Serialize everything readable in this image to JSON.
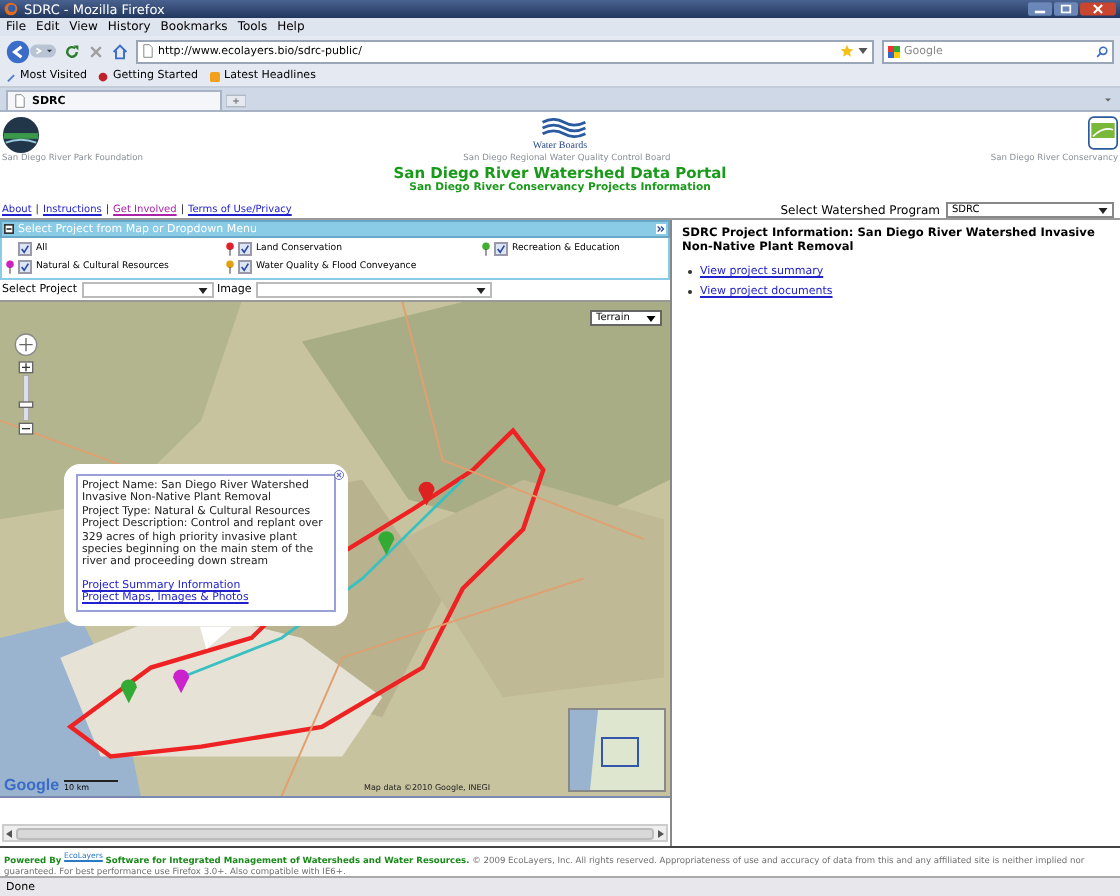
{
  "window": {
    "title": "SDRC - Mozilla Firefox"
  },
  "menu": [
    "File",
    "Edit",
    "View",
    "History",
    "Bookmarks",
    "Tools",
    "Help"
  ],
  "address_bar": {
    "value": "http://www.ecolayers.bio/sdrc-public/"
  },
  "search": {
    "placeholder": "Google"
  },
  "bookmarks": [
    "Most Visited",
    "Getting Started",
    "Latest Headlines"
  ],
  "tabs": [
    {
      "label": "SDRC",
      "selected": true
    }
  ],
  "header": {
    "partners": [
      "San Diego River Park Foundation",
      "San Diego Regional Water Quality Control Board",
      "San Diego River Conservancy"
    ],
    "logo_text": "Water Boards",
    "title": "San Diego River Watershed Data Portal",
    "subtitle": "San Diego River Conservancy Projects Information"
  },
  "links": [
    {
      "label": "About",
      "visited": false
    },
    {
      "label": "Instructions",
      "visited": false
    },
    {
      "label": "Get Involved",
      "visited": true
    },
    {
      "label": "Terms of Use/Privacy",
      "visited": false
    }
  ],
  "link_separator": "|",
  "watershed_select": {
    "label": "Select Watershed Program",
    "value": "SDRC"
  },
  "project_panel": {
    "title": "Select Project from Map or Dropdown Menu",
    "filters": [
      {
        "label": "All",
        "checked": true
      },
      {
        "label": "Land Conservation",
        "checked": true,
        "color": "#e0202a"
      },
      {
        "label": "Recreation & Education",
        "checked": true,
        "color": "#40b030"
      },
      {
        "label": "Natural & Cultural Resources",
        "checked": true,
        "color": "#d020c0"
      },
      {
        "label": "Water Quality & Flood Conveyance",
        "checked": true,
        "color": "#e0a010"
      }
    ],
    "project_select": {
      "label": "Select Project"
    },
    "image_select": {
      "label": "Image"
    }
  },
  "map": {
    "map_type": "Terrain",
    "logo": "Google",
    "scale": "10 km",
    "attribution": "Map data ©2010 Google, INEGI",
    "popup": {
      "lines": [
        "Project Name: San Diego River Watershed Invasive Non-Native Plant Removal",
        "Project Type: Natural & Cultural Resources",
        "Project Description: Control and replant over 329 acres of high priority invasive plant species beginning on the main stem of the river and proceeding down stream"
      ],
      "links": [
        "Project Summary Information",
        "Project Maps, Images & Photos"
      ]
    }
  },
  "project_info": {
    "title": "SDRC Project Information: San Diego River Watershed Invasive Non-Native Plant Removal",
    "links": [
      "View project summary",
      "View project documents"
    ]
  },
  "footer": {
    "powered_by": "Powered By",
    "brand": "EcoLayers",
    "tagline": "Software for Integrated Management of Watersheds and Water Resources.",
    "notice": "© 2009 EcoLayers, Inc. All rights reserved. Appropriateness of use and accuracy of data from this and any affiliated site is neither implied nor guaranteed. For best performance use Firefox 3.0+. Also compatible with IE6+."
  },
  "status_bar": "Done"
}
